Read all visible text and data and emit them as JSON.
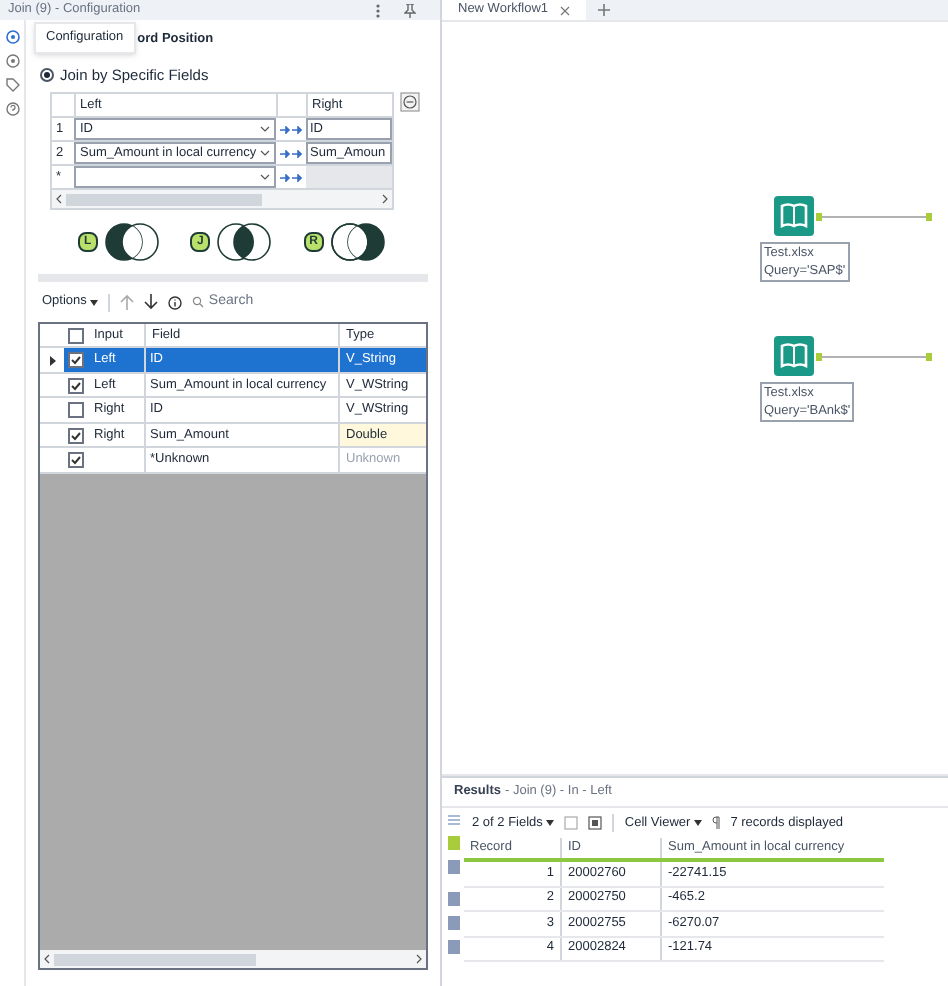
{
  "window": {
    "title": "Join (9) - Configuration"
  },
  "config_tabs": [
    {
      "label": "Configuration",
      "selected": true
    },
    {
      "label": "ord Position",
      "selected": false
    }
  ],
  "join_option": {
    "label": "Join by Specific Fields",
    "selected": true
  },
  "join_fields": {
    "columns": [
      "Left",
      "Right"
    ],
    "rows": [
      {
        "index": "1",
        "left": "ID",
        "right": "ID"
      },
      {
        "index": "2",
        "left": "Sum_Amount in local currency",
        "right": "Sum_Amoun"
      },
      {
        "index": "*"
      }
    ]
  },
  "venn": [
    {
      "label": "L",
      "kind": "left"
    },
    {
      "label": "J",
      "kind": "inner"
    },
    {
      "label": "R",
      "kind": "right"
    }
  ],
  "toolbar": {
    "options": "Options",
    "search_placeholder": "Search"
  },
  "fields_table": {
    "all_checked": false,
    "columns": [
      "Input",
      "Field",
      "Type"
    ],
    "rows": [
      {
        "checked": true,
        "selected": true,
        "input": "Left",
        "field": "ID",
        "type": "V_String",
        "kind": "normal"
      },
      {
        "checked": true,
        "selected": false,
        "input": "Left",
        "field": "Sum_Amount in local currency",
        "type": "V_WString",
        "kind": "normal"
      },
      {
        "checked": false,
        "selected": false,
        "input": "Right",
        "field": "ID",
        "type": "V_WString",
        "kind": "normal"
      },
      {
        "checked": true,
        "selected": false,
        "input": "Right",
        "field": "Sum_Amount",
        "type": "Double",
        "kind": "changed"
      },
      {
        "checked": true,
        "selected": false,
        "field": "*Unknown",
        "type": "Unknown",
        "kind": "unknown"
      }
    ]
  },
  "workflow_tabs": [
    {
      "label": "New Workflow1",
      "selected": true
    }
  ],
  "canvas": {
    "nodes": [
      {
        "lines": [
          "Test.xlsx",
          "Query='SAP$'"
        ]
      },
      {
        "lines": [
          "Test.xlsx",
          "Query='BAnk$'"
        ]
      }
    ]
  },
  "results": {
    "title": "Results",
    "path": "- Join (9) - In - Left",
    "fields": "2 of 2 Fields",
    "cell_viewer": "Cell Viewer",
    "records": "7 records displayed",
    "columns": [
      "Record",
      "ID",
      "Sum_Amount in local currency"
    ],
    "rows": [
      [
        "1",
        "20002760",
        "-22741.15"
      ],
      [
        "2",
        "20002750",
        "-465.2"
      ],
      [
        "3",
        "20002755",
        "-6270.07"
      ],
      [
        "4",
        "20002824",
        "-121.74"
      ]
    ]
  }
}
